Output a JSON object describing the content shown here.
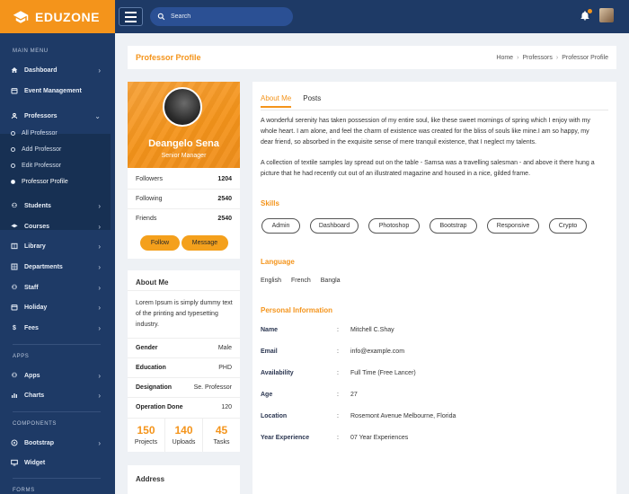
{
  "brand": {
    "name": "EDUZONE"
  },
  "search": {
    "placeholder": "Search"
  },
  "sidebar": {
    "main_menu_label": "MAIN MENU",
    "apps_label": "APPS",
    "components_label": "COMPONENTS",
    "forms_label": "FORMS",
    "items": [
      {
        "label": "Dashboard"
      },
      {
        "label": "Event Management"
      },
      {
        "label": "Professors"
      },
      {
        "label": "Students"
      },
      {
        "label": "Courses"
      },
      {
        "label": "Library"
      },
      {
        "label": "Departments"
      },
      {
        "label": "Staff"
      },
      {
        "label": "Holiday"
      },
      {
        "label": "Fees"
      },
      {
        "label": "Apps"
      },
      {
        "label": "Charts"
      },
      {
        "label": "Bootstrap"
      },
      {
        "label": "Widget"
      }
    ],
    "sub_items": [
      {
        "label": "All Professor"
      },
      {
        "label": "Add Professor"
      },
      {
        "label": "Edit Professor"
      },
      {
        "label": "Professor Profile"
      }
    ]
  },
  "page": {
    "title": "Professor Profile",
    "breadcrumb": [
      "Home",
      "Professors",
      "Professor Profile"
    ]
  },
  "profile": {
    "name": "Deangelo Sena",
    "role": "Senior Manager",
    "stats": [
      {
        "label": "Followers",
        "value": "1204"
      },
      {
        "label": "Following",
        "value": "2540"
      },
      {
        "label": "Friends",
        "value": "2540"
      }
    ],
    "follow_label": "Follow",
    "message_label": "Message"
  },
  "about_card": {
    "title": "About Me",
    "description": "Lorem Ipsum is simply dummy text of the printing and typesetting industry.",
    "rows": [
      {
        "label": "Gender",
        "value": "Male"
      },
      {
        "label": "Education",
        "value": "PHD"
      },
      {
        "label": "Designation",
        "value": "Se. Professor"
      },
      {
        "label": "Operation Done",
        "value": "120"
      }
    ],
    "counts": [
      {
        "num": "150",
        "label": "Projects"
      },
      {
        "num": "140",
        "label": "Uploads"
      },
      {
        "num": "45",
        "label": "Tasks"
      }
    ]
  },
  "address_card": {
    "title": "Address"
  },
  "tabs": [
    {
      "label": "About Me"
    },
    {
      "label": "Posts"
    }
  ],
  "about": {
    "para1": "A wonderful serenity has taken possession of my entire soul, like these sweet mornings of spring which I enjoy with my whole heart. I am alone, and feel the charm of existence was created for the bliss of souls like mine.I am so happy, my dear friend, so absorbed in the exquisite sense of mere tranquil existence, that I neglect my talents.",
    "para2": "A collection of textile samples lay spread out on the table - Samsa was a travelling salesman - and above it there hung a picture that he had recently cut out of an illustrated magazine and housed in a nice, gilded frame."
  },
  "skills": {
    "title": "Skills",
    "items": [
      "Admin",
      "Dashboard",
      "Photoshop",
      "Bootstrap",
      "Responsive",
      "Crypto"
    ]
  },
  "language": {
    "title": "Language",
    "items": [
      "English",
      "French",
      "Bangla"
    ]
  },
  "personal": {
    "title": "Personal Information",
    "rows": [
      {
        "label": "Name",
        "value": "Mitchell C.Shay"
      },
      {
        "label": "Email",
        "value": "info@example.com"
      },
      {
        "label": "Availability",
        "value": "Full Time (Free Lancer)"
      },
      {
        "label": "Age",
        "value": "27"
      },
      {
        "label": "Location",
        "value": "Rosemont Avenue Melbourne, Florida"
      },
      {
        "label": "Year Experience",
        "value": "07 Year Experiences"
      }
    ]
  },
  "colors": {
    "accent": "#f4941b",
    "sidebar": "#1e3a66",
    "search": "#2b5094"
  }
}
